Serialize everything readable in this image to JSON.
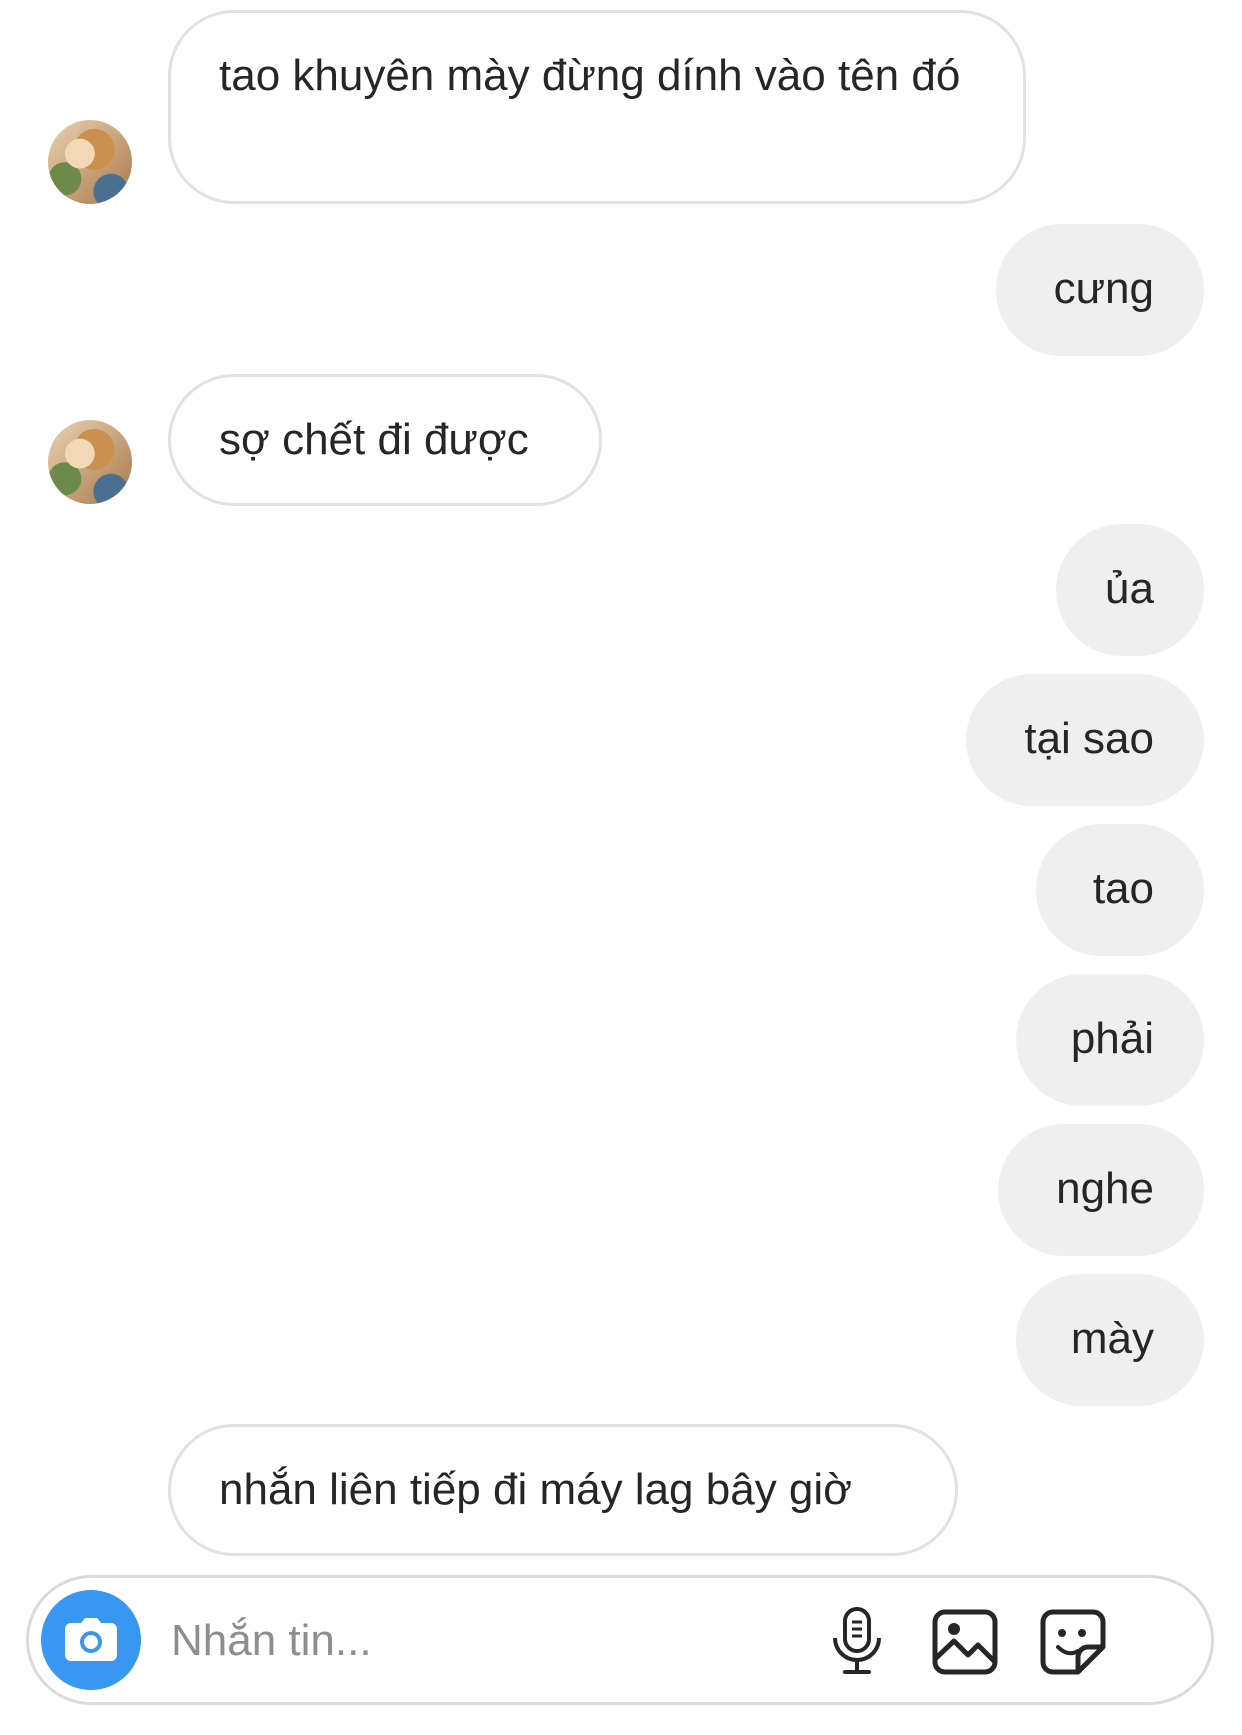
{
  "messages": [
    {
      "side": "received",
      "text": "tao khuyên mày đừng dính vào tên đó",
      "avatar": true
    },
    {
      "side": "sent",
      "text": "cưng"
    },
    {
      "side": "received",
      "text": "sợ chết đi được",
      "avatar": true
    },
    {
      "side": "sent",
      "text": "ủa"
    },
    {
      "side": "sent",
      "text": "tại sao"
    },
    {
      "side": "sent",
      "text": "tao"
    },
    {
      "side": "sent",
      "text": "phải"
    },
    {
      "side": "sent",
      "text": "nghe"
    },
    {
      "side": "sent",
      "text": "mày"
    },
    {
      "side": "received",
      "text": "nhắn liên tiếp đi máy lag bây giờ",
      "avatar": false
    }
  ],
  "composer": {
    "placeholder": "Nhắn tin...",
    "icons": {
      "camera": "camera-icon",
      "mic": "microphone-icon",
      "gallery": "gallery-icon",
      "sticker": "sticker-icon"
    }
  },
  "colors": {
    "sent_bubble": "#efefef",
    "received_border": "#e2e2e2",
    "camera_button": "#3897f0",
    "text": "#262626",
    "placeholder": "#8e8e8e"
  }
}
